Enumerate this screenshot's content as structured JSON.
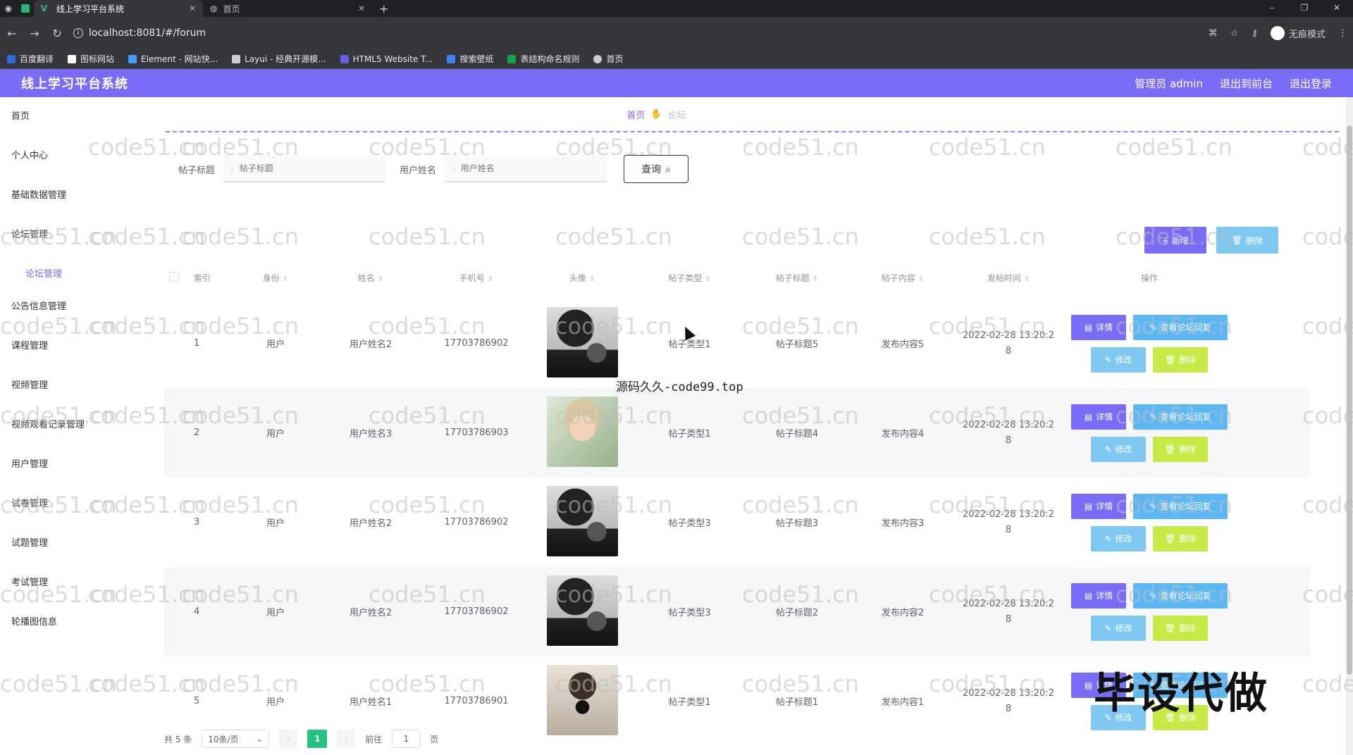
{
  "browser": {
    "tabs": [
      {
        "label": "线上学习平台系统",
        "active": true
      },
      {
        "label": "首页",
        "active": false
      }
    ],
    "new_tab": "+",
    "url": "localhost:8081/#/forum",
    "profile_label": "无痕模式",
    "window_controls": [
      "–",
      "❐",
      "✕"
    ]
  },
  "bookmarks": [
    {
      "label": "百度翻译",
      "color": "#2f6be0"
    },
    {
      "label": "图标网站",
      "color": "#ffffff"
    },
    {
      "label": "Element - 网站快...",
      "color": "#409eff"
    },
    {
      "label": "Layui - 经典开源模...",
      "color": "#cccccc"
    },
    {
      "label": "HTML5 Website T...",
      "color": "#6c5ce7"
    },
    {
      "label": "搜索壁纸",
      "color": "#3b82f6"
    },
    {
      "label": "表结构命名规则",
      "color": "#16a34a"
    },
    {
      "label": "首页",
      "color": "#cccccc"
    }
  ],
  "app": {
    "title": "线上学习平台系统",
    "header_links": [
      "管理员 admin",
      "退出到前台",
      "退出登录"
    ],
    "accent": "#7a6cf6"
  },
  "sidebar": {
    "items": [
      {
        "label": "首页"
      },
      {
        "label": "个人中心"
      },
      {
        "label": "基础数据管理"
      },
      {
        "label": "论坛管理"
      },
      {
        "label": "论坛管理",
        "sub": true
      },
      {
        "label": "公告信息管理"
      },
      {
        "label": "课程管理"
      },
      {
        "label": "视频管理"
      },
      {
        "label": "视频观看记录管理"
      },
      {
        "label": "用户管理"
      },
      {
        "label": "试卷管理"
      },
      {
        "label": "试题管理"
      },
      {
        "label": "考试管理"
      },
      {
        "label": "轮播图信息"
      }
    ]
  },
  "breadcrumb": {
    "home": "首页",
    "current": "论坛"
  },
  "search": {
    "title_label": "帖子标题",
    "title_placeholder": "帖子标题",
    "user_label": "用户姓名",
    "user_placeholder": "用户姓名",
    "query_button": "查询"
  },
  "actions": {
    "add": "+ 新增",
    "delete": "删除"
  },
  "table": {
    "columns": [
      "索引",
      "身份",
      "姓名",
      "手机号",
      "头像",
      "帖子类型",
      "帖子标题",
      "帖子内容",
      "发帖时间",
      "操作"
    ],
    "rows": [
      {
        "index": "1",
        "role": "用户",
        "name": "用户姓名2",
        "phone": "17703786902",
        "avatar": "av-dark",
        "type": "帖子类型1",
        "title": "帖子标题5",
        "content": "发布内容5",
        "time1": "2022-02-28 13:20:2",
        "time2": "8"
      },
      {
        "index": "2",
        "role": "用户",
        "name": "用户姓名3",
        "phone": "17703786903",
        "avatar": "av-light",
        "type": "帖子类型1",
        "title": "帖子标题4",
        "content": "发布内容4",
        "time1": "2022-02-28 13:20:2",
        "time2": "8"
      },
      {
        "index": "3",
        "role": "用户",
        "name": "用户姓名2",
        "phone": "17703786902",
        "avatar": "av-dark",
        "type": "帖子类型3",
        "title": "帖子标题3",
        "content": "发布内容3",
        "time1": "2022-02-28 13:20:2",
        "time2": "8"
      },
      {
        "index": "4",
        "role": "用户",
        "name": "用户姓名2",
        "phone": "17703786902",
        "avatar": "av-dark",
        "type": "帖子类型3",
        "title": "帖子标题2",
        "content": "发布内容2",
        "time1": "2022-02-28 13:20:2",
        "time2": "8"
      },
      {
        "index": "5",
        "role": "用户",
        "name": "用户姓名1",
        "phone": "17703786901",
        "avatar": "av-mirror",
        "type": "帖子类型1",
        "title": "帖子标题1",
        "content": "发布内容1",
        "time1": "2022-02-28 13:20:2",
        "time2": "8"
      }
    ],
    "row_buttons": {
      "detail": "详情",
      "reply": "查看论坛回复",
      "edit": "修改",
      "remove": "删除"
    }
  },
  "pagination": {
    "total": "共 5 条",
    "page_size": "10条/页",
    "current": "1",
    "goto_prefix": "前往",
    "goto_value": "1",
    "goto_suffix": "页"
  },
  "overlays": {
    "watermark": "code51.cn",
    "code_text": "源码久久-code99.top",
    "big_text": "毕设代做"
  }
}
